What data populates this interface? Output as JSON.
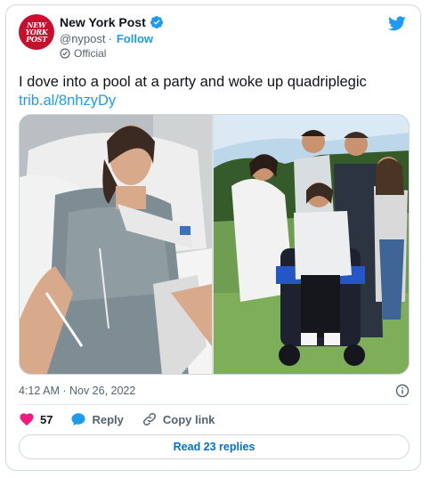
{
  "tweet": {
    "author_name": "New York Post",
    "avatar_text": [
      "NEW",
      "YORK",
      "POST"
    ],
    "handle": "@nypost",
    "separator": "·",
    "follow_label": "Follow",
    "badge_label": "Official",
    "text": "I dove into a pool at a party and woke up quadriplegic",
    "link": "trib.al/8nhzyDy",
    "timestamp": "4:12 AM · Nov 26, 2022"
  },
  "actions": {
    "like_count": "57",
    "reply_label": "Reply",
    "copy_label": "Copy link"
  },
  "footer": {
    "read_replies_label": "Read 23 replies"
  },
  "colors": {
    "brand_blue": "#1d9bf0",
    "like_red": "#f91880",
    "avatar_red": "#c8102e"
  },
  "icons": [
    "verified-icon",
    "twitter-bird-icon",
    "official-badge-icon",
    "info-icon",
    "heart-icon",
    "reply-bubble-icon",
    "link-icon"
  ]
}
